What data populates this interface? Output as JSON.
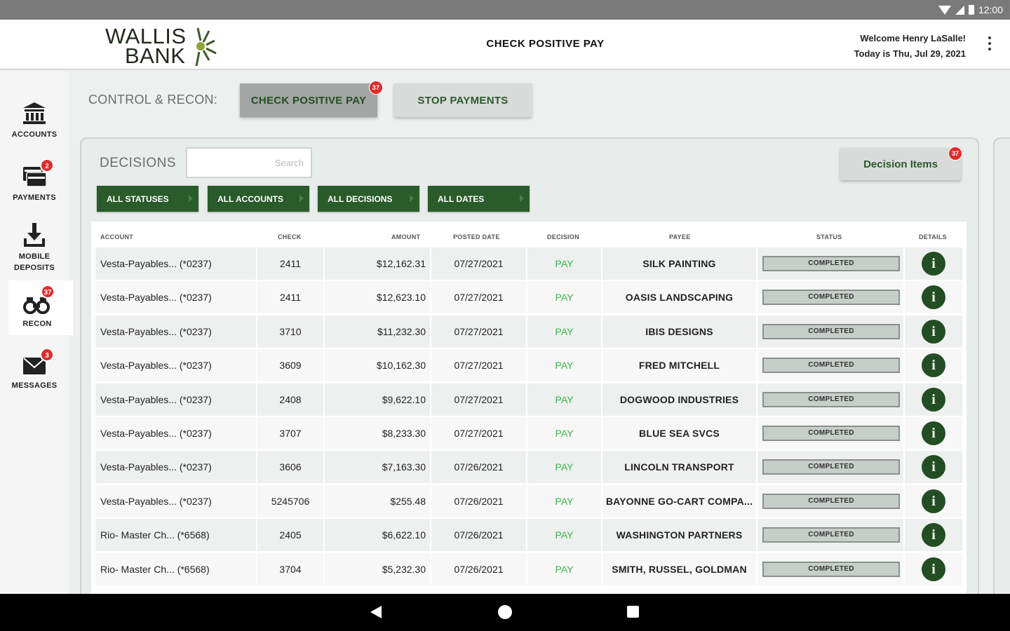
{
  "status_bar": {
    "time": "12:00"
  },
  "header": {
    "logo_line1": "WALLIS",
    "logo_line2": "BANK",
    "title": "CHECK POSITIVE PAY",
    "welcome": "Welcome Henry LaSalle!",
    "today": "Today is Thu, Jul 29, 2021"
  },
  "sidebar": {
    "items": [
      {
        "label": "ACCOUNTS",
        "icon": "bank-icon",
        "badge": ""
      },
      {
        "label": "PAYMENTS",
        "icon": "payments-icon",
        "badge": "2"
      },
      {
        "label_line1": "MOBILE",
        "label_line2": "DEPOSITS",
        "icon": "download-icon",
        "badge": ""
      },
      {
        "label": "RECON",
        "icon": "binoculars-icon",
        "badge": "37",
        "active": true
      },
      {
        "label": "MESSAGES",
        "icon": "envelope-icon",
        "badge": "3"
      }
    ]
  },
  "control": {
    "label": "CONTROL & RECON:",
    "tabs": [
      {
        "label": "CHECK POSITIVE PAY",
        "badge": "37",
        "active": true
      },
      {
        "label": "STOP PAYMENTS",
        "badge": ""
      }
    ]
  },
  "decisions": {
    "label": "DECISIONS",
    "search_placeholder": "Search",
    "decision_items_label": "Decision Items",
    "decision_items_badge": "37",
    "filters": [
      "ALL STATUSES",
      "ALL ACCOUNTS",
      "ALL DECISIONS",
      "ALL DATES"
    ]
  },
  "table": {
    "columns": [
      "ACCOUNT",
      "CHECK",
      "AMOUNT",
      "POSTED DATE",
      "DECISION",
      "PAYEE",
      "STATUS",
      "DETAILS"
    ],
    "rows": [
      {
        "account": "Vesta-Payables... (*0237)",
        "check": "2411",
        "amount": "$12,162.31",
        "date": "07/27/2021",
        "decision": "PAY",
        "payee": "SILK PAINTING",
        "status": "COMPLETED"
      },
      {
        "account": "Vesta-Payables... (*0237)",
        "check": "2411",
        "amount": "$12,623.10",
        "date": "07/27/2021",
        "decision": "PAY",
        "payee": "OASIS LANDSCAPING",
        "status": "COMPLETED"
      },
      {
        "account": "Vesta-Payables... (*0237)",
        "check": "3710",
        "amount": "$11,232.30",
        "date": "07/27/2021",
        "decision": "PAY",
        "payee": "IBIS DESIGNS",
        "status": "COMPLETED"
      },
      {
        "account": "Vesta-Payables... (*0237)",
        "check": "3609",
        "amount": "$10,162.30",
        "date": "07/27/2021",
        "decision": "PAY",
        "payee": "FRED MITCHELL",
        "status": "COMPLETED"
      },
      {
        "account": "Vesta-Payables... (*0237)",
        "check": "2408",
        "amount": "$9,622.10",
        "date": "07/27/2021",
        "decision": "PAY",
        "payee": "DOGWOOD INDUSTRIES",
        "status": "COMPLETED"
      },
      {
        "account": "Vesta-Payables... (*0237)",
        "check": "3707",
        "amount": "$8,233.30",
        "date": "07/27/2021",
        "decision": "PAY",
        "payee": "BLUE SEA SVCS",
        "status": "COMPLETED"
      },
      {
        "account": "Vesta-Payables... (*0237)",
        "check": "3606",
        "amount": "$7,163.30",
        "date": "07/26/2021",
        "decision": "PAY",
        "payee": "LINCOLN TRANSPORT",
        "status": "COMPLETED"
      },
      {
        "account": "Vesta-Payables... (*0237)",
        "check": "5245706",
        "amount": "$255.48",
        "date": "07/26/2021",
        "decision": "PAY",
        "payee": "BAYONNE GO-CART COMPA...",
        "status": "COMPLETED"
      },
      {
        "account": "Rio- Master Ch... (*6568)",
        "check": "2405",
        "amount": "$6,622.10",
        "date": "07/26/2021",
        "decision": "PAY",
        "payee": "WASHINGTON PARTNERS",
        "status": "COMPLETED"
      },
      {
        "account": "Rio- Master Ch... (*6568)",
        "check": "3704",
        "amount": "$5,232.30",
        "date": "07/26/2021",
        "decision": "PAY",
        "payee": "SMITH, RUSSEL, GOLDMAN",
        "status": "COMPLETED"
      }
    ]
  },
  "colors": {
    "brand_green": "#2a5b2a",
    "pay_green": "#3bb54a",
    "badge_red": "#e02b2b",
    "logo_green": "#8fa33a"
  }
}
